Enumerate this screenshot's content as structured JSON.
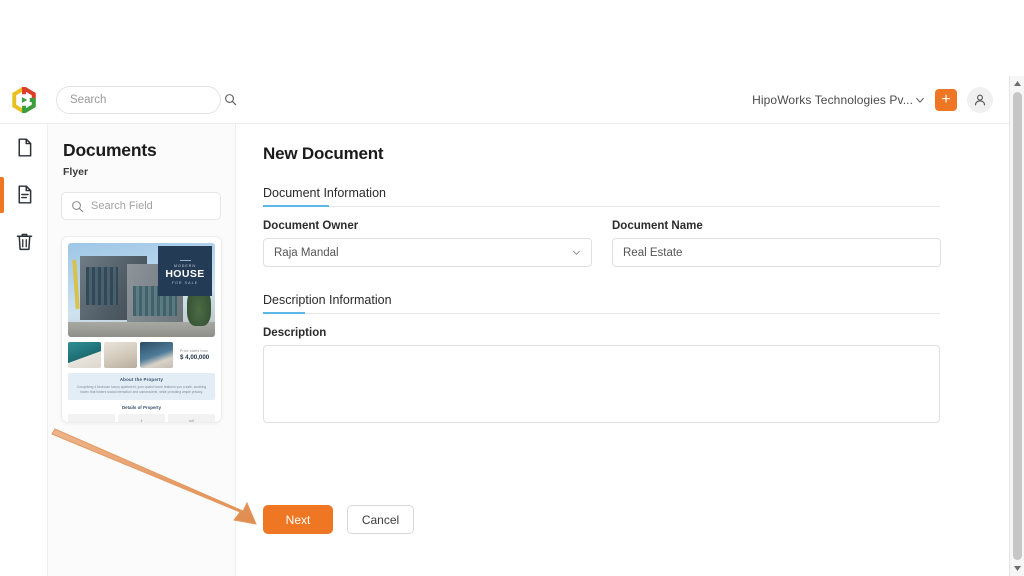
{
  "header": {
    "logo_icon": "hipoworks-hexagon-logo",
    "search": {
      "value": "",
      "placeholder": "Search",
      "icon": "search-icon"
    },
    "org_name": "HipoWorks Technologies Pv...",
    "org_chevron_icon": "chevron-down-icon",
    "add_button_label": "+",
    "add_button_icon": "plus-icon",
    "account_icon": "user-avatar-icon",
    "accent_color": "#ef7622"
  },
  "rail": {
    "items": [
      {
        "icon": "document-blank-icon",
        "active": false
      },
      {
        "icon": "document-lines-icon",
        "active": true
      },
      {
        "icon": "trash-icon",
        "active": false
      }
    ]
  },
  "panel": {
    "title": "Documents",
    "subtitle": "Flyer",
    "search": {
      "value": "",
      "placeholder": "Search Field",
      "icon": "search-icon"
    },
    "document_card": {
      "badge_eyebrow": "MODERN",
      "badge_title": "HOUSE",
      "badge_subtitle": "FOR SALE",
      "price_label": "Price starts from",
      "price_value": "$ 4,00,000",
      "about_title": "About the Property",
      "about_body": "Comprising 4 bedroom luxury apartment, your quaint home features you a safe, soothing haven that fosters social interaction and camaraderie, while providing ample privacy.",
      "details_title": "Details of Property",
      "detail_cells": [
        "",
        "ft",
        "sqft"
      ]
    }
  },
  "main": {
    "page_title": "New Document",
    "sections": [
      {
        "title": "Document Information"
      },
      {
        "title": "Description Information"
      }
    ],
    "fields": {
      "document_owner": {
        "label": "Document Owner",
        "value": "Raja Mandal",
        "placeholder": "",
        "chevron_icon": "chevron-down-icon"
      },
      "document_name": {
        "label": "Document Name",
        "value": "Real Estate",
        "placeholder": ""
      },
      "description": {
        "label": "Description",
        "value": "",
        "placeholder": ""
      }
    },
    "buttons": {
      "next": "Next",
      "cancel": "Cancel"
    }
  },
  "annotation": {
    "arrow_icon": "pointer-arrow-annotation",
    "color": "#e8a87c"
  },
  "scrollbar": {
    "up_icon": "scroll-up-arrow-icon",
    "down_icon": "scroll-down-arrow-icon"
  }
}
